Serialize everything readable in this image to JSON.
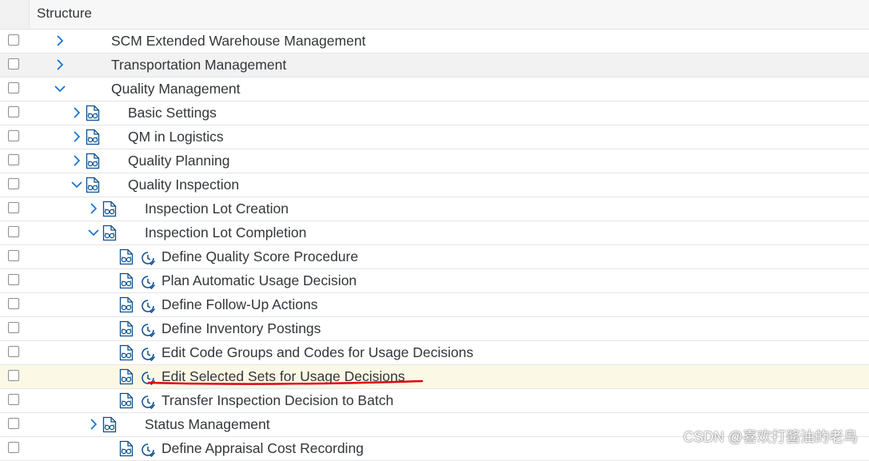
{
  "header": {
    "title": "Structure"
  },
  "colors": {
    "accent": "#0a6ed1",
    "highlight_row": "#fcf8e6",
    "underline": "#e0000f"
  },
  "tree": [
    {
      "label": "SCM Extended Warehouse Management",
      "expand": "collapsed",
      "icons": []
    },
    {
      "label": "Transportation Management",
      "expand": "collapsed",
      "icons": []
    },
    {
      "label": "Quality Management",
      "expand": "expanded",
      "icons": []
    },
    {
      "label": "Basic Settings",
      "expand": "collapsed",
      "icons": [
        "doc-glasses-icon"
      ]
    },
    {
      "label": "QM in Logistics",
      "expand": "collapsed",
      "icons": [
        "doc-glasses-icon"
      ]
    },
    {
      "label": "Quality Planning",
      "expand": "collapsed",
      "icons": [
        "doc-glasses-icon"
      ]
    },
    {
      "label": "Quality Inspection",
      "expand": "expanded",
      "icons": [
        "doc-glasses-icon"
      ]
    },
    {
      "label": "Inspection Lot Creation",
      "expand": "collapsed",
      "icons": [
        "doc-glasses-icon"
      ]
    },
    {
      "label": "Inspection Lot Completion",
      "expand": "expanded",
      "icons": [
        "doc-glasses-icon"
      ]
    },
    {
      "label": "Define Quality Score Procedure",
      "expand": "none",
      "icons": [
        "doc-glasses-icon",
        "clock-check-icon"
      ]
    },
    {
      "label": "Plan Automatic Usage Decision",
      "expand": "none",
      "icons": [
        "doc-glasses-icon",
        "clock-check-icon"
      ]
    },
    {
      "label": "Define Follow-Up Actions",
      "expand": "none",
      "icons": [
        "doc-glasses-icon",
        "clock-check-icon"
      ]
    },
    {
      "label": "Define Inventory Postings",
      "expand": "none",
      "icons": [
        "doc-glasses-icon",
        "clock-check-icon"
      ]
    },
    {
      "label": "Edit Code Groups and Codes for Usage Decisions",
      "expand": "none",
      "icons": [
        "doc-glasses-icon",
        "clock-check-icon"
      ]
    },
    {
      "label": "Edit Selected Sets for Usage Decisions",
      "expand": "none",
      "icons": [
        "doc-glasses-icon",
        "clock-check-icon"
      ],
      "selected": true
    },
    {
      "label": "Transfer Inspection Decision to Batch",
      "expand": "none",
      "icons": [
        "doc-glasses-icon",
        "clock-check-icon"
      ]
    },
    {
      "label": "Status Management",
      "expand": "collapsed",
      "icons": [
        "doc-glasses-icon"
      ]
    },
    {
      "label": "Define Appraisal Cost Recording",
      "expand": "none",
      "icons": [
        "doc-glasses-icon",
        "clock-check-icon"
      ]
    }
  ],
  "watermark": "CSDN @喜欢打酱油的老鸟"
}
